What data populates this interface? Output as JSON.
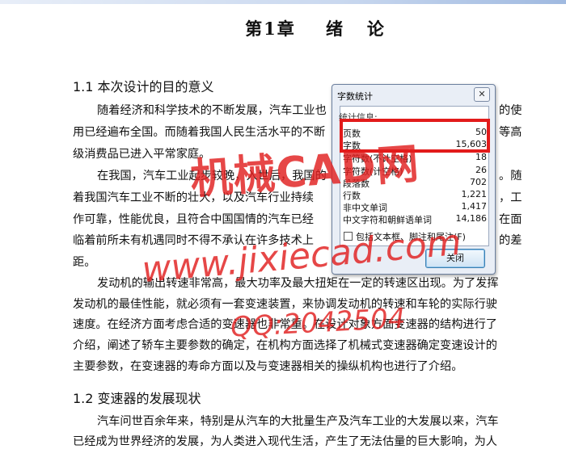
{
  "document": {
    "chapter_title": "第1章    绪   论",
    "section_1_1": "1.1 本次设计的目的意义",
    "p1": [
      "随着经济和科学技术的不断发展，汽车工业也",
      "用已经遍布全国。而随着我国人民生活水平的不断",
      "级消费品已进入平常家庭。"
    ],
    "p1_right": [
      "的使",
      "等高"
    ],
    "p2": [
      "在我国，汽车工业起步较晚，入世后，我国的",
      "着我国汽车工业不断的壮大，以及汽车行业持续",
      "作可靠，性能优良，且符合中国国情的汽车已经",
      "临着前所未有机遇同时不得不承认在许多技术上",
      "距。"
    ],
    "p2_right": [
      "。随",
      "，工",
      "在面",
      "的差"
    ],
    "p3": [
      "发动机的输出转速非常高，最大功率及最大扭矩在一定的转速区出现。为了发挥",
      "发动机的最佳性能，就必须有一套变速装置，来协调发动机的转速和车轮的实际行驶",
      "速度。在经济方面考虑合适的变速器也非常重。在设计对象方面变速器的结构进行了",
      "介绍，阐述了轿车主要参数的确定，在机构方面选择了机械式变速器确定变速设计的",
      "主要参数，在变速器的寿命方面以及与变速器相关的操纵机构也进行了介绍。"
    ],
    "section_1_2": "1.2 变速器的发展现状",
    "p4": [
      "汽车问世百余年来，特别是从汽车的大批量生产及汽车工业的大发展以来，汽车",
      "已经成为世界经济的发展，为人类进入现代生活，产生了无法估量的巨大影响，为人"
    ]
  },
  "watermark": {
    "line1": "机械CAD网",
    "line2": "www.jixiecad.com",
    "line3": "QQ:2042504"
  },
  "dialog": {
    "title": "字数统计",
    "close_x": "✕",
    "section_label": "统计信息:",
    "stats": [
      {
        "label": "页数",
        "value": "50"
      },
      {
        "label": "字数",
        "value": "15,603"
      },
      {
        "label": "字符数(不计空格)",
        "value": "18"
      },
      {
        "label": "字符数(计空格)",
        "value": "26"
      },
      {
        "label": "段落数",
        "value": "702"
      },
      {
        "label": "行数",
        "value": "1,221"
      },
      {
        "label": "非中文单词",
        "value": "1,417"
      },
      {
        "label": "中文字符和朝鲜语单词",
        "value": "14,186"
      }
    ],
    "checkbox_label": "包括文本框、脚注和尾注(F)",
    "close_button": "关闭"
  }
}
